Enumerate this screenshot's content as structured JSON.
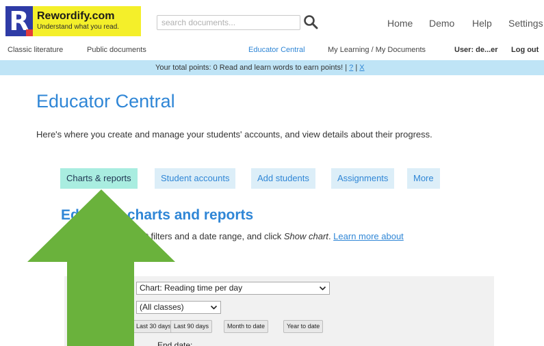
{
  "header": {
    "logo_letter": "R",
    "logo_title": "Rewordify.com",
    "logo_subtitle": "Understand what you read.",
    "search_placeholder": "search documents...",
    "nav": [
      "Home",
      "Demo",
      "Help",
      "Settings"
    ]
  },
  "subnav": {
    "items": [
      "Classic literature",
      "Public documents",
      "Educator Central",
      "My Learning / My Documents"
    ],
    "user": "User: de...er",
    "logout": "Log out"
  },
  "pointsbar": {
    "text": "Your total points: 0  Read and learn words to earn points! | ",
    "help_link": "?",
    "sep": " | ",
    "close_link": "X"
  },
  "main": {
    "title": "Educator Central",
    "intro": "Here's where you create and manage your students' accounts, and view details about their progress.",
    "tabs": [
      {
        "label": "Charts & reports",
        "active": true
      },
      {
        "label": "Student accounts",
        "active": false
      },
      {
        "label": "Add students",
        "active": false
      },
      {
        "label": "Assignments",
        "active": false
      },
      {
        "label": "More",
        "active": false
      }
    ],
    "section_title": "Educator charts and reports",
    "section_desc_1": "To view a chart, select filters and a date range, and click ",
    "section_desc_em": "Show chart",
    "section_desc_2": ". ",
    "section_desc_link": "Learn more about"
  },
  "filters": {
    "chart_select_value": "Chart: Reading time per day",
    "class_select_value": "(All classes)",
    "range_buttons": [
      "Last 30 days",
      "Last 90 days",
      "Month to date",
      "Year to date"
    ],
    "end_date_label": "End date:"
  },
  "colors": {
    "accent_blue": "#2f86d6",
    "logo_yellow": "#f4ef2a",
    "logo_navy": "#2e3ba6",
    "points_bar": "#bfe4f6",
    "active_tab": "#a9ede0",
    "tab": "#dceef8",
    "arrow_green": "#6ab23c"
  }
}
